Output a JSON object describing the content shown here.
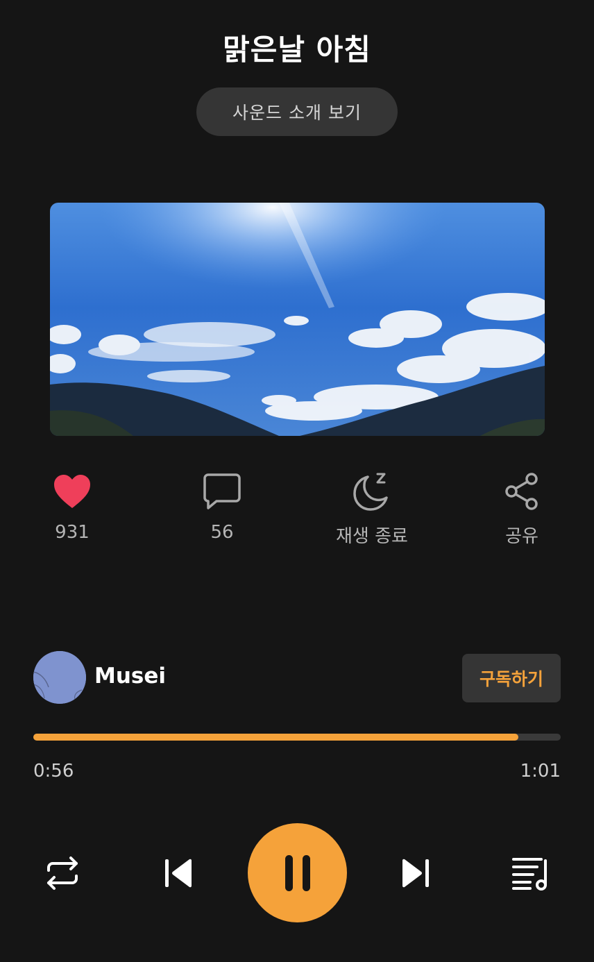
{
  "header": {
    "title": "맑은날 아침",
    "intro_button": "사운드 소개 보기"
  },
  "actions": {
    "like": {
      "icon": "heart-icon",
      "count": "931",
      "color": "#ef3f5a"
    },
    "comment": {
      "icon": "comment-icon",
      "count": "56"
    },
    "sleep_timer": {
      "icon": "moon-sleep-icon",
      "label": "재생 종료"
    },
    "share": {
      "icon": "share-icon",
      "label": "공유"
    }
  },
  "creator": {
    "name": "Musei",
    "subscribe_label": "구독하기"
  },
  "player": {
    "progress_fraction": 0.92,
    "current_time": "0:56",
    "total_time": "1:01",
    "accent_color": "#f5a23a"
  },
  "controls": {
    "repeat": "repeat-icon",
    "previous": "skip-previous-icon",
    "play_pause": "pause-icon",
    "next": "skip-next-icon",
    "playlist": "playlist-icon"
  }
}
